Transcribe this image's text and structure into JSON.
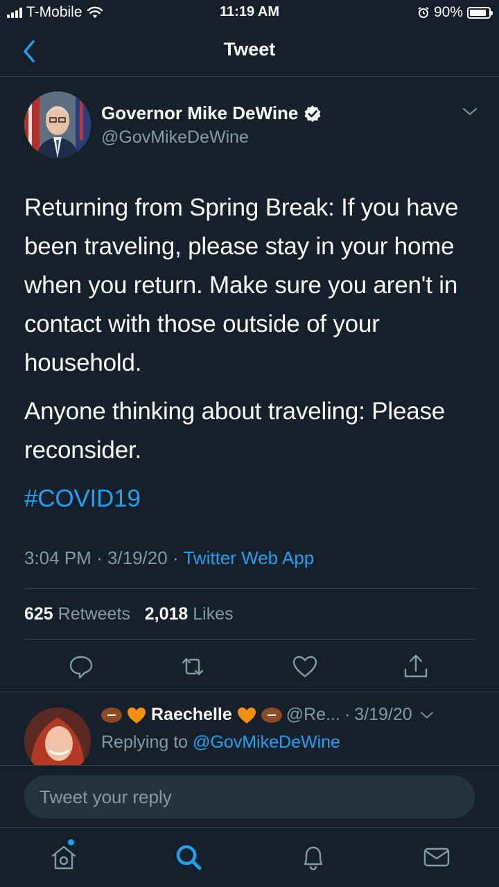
{
  "status_bar": {
    "carrier": "T-Mobile",
    "time": "11:19 AM",
    "battery": "90%"
  },
  "header": {
    "title": "Tweet"
  },
  "tweet": {
    "author_name": "Governor Mike DeWine",
    "author_handle": "@GovMikeDeWine",
    "paragraph1": "Returning from Spring Break: If you have been traveling, please stay in your home when you return. Make sure you aren't in contact with those outside of your household.",
    "paragraph2": "Anyone thinking about traveling: Please reconsider.",
    "hashtag": "#COVID19",
    "time": "3:04 PM",
    "date": "3/19/20",
    "source": "Twitter Web App",
    "retweets_count": "625",
    "retweets_label": "Retweets",
    "likes_count": "2,018",
    "likes_label": "Likes"
  },
  "reply": {
    "name": "Raechelle",
    "handle": "@Re...",
    "date": "3/19/20",
    "replying_label": "Replying to",
    "replying_to": "@GovMikeDeWine"
  },
  "composer": {
    "placeholder": "Tweet your reply"
  },
  "colors": {
    "background": "#15202b",
    "accent": "#1da1f2",
    "secondary_text": "#8899a6"
  },
  "icons": [
    "back-chevron-icon",
    "verified-badge-icon",
    "chevron-down-icon",
    "reply-icon",
    "retweet-icon",
    "like-icon",
    "share-icon",
    "home-icon",
    "search-icon",
    "notifications-icon",
    "messages-icon"
  ]
}
